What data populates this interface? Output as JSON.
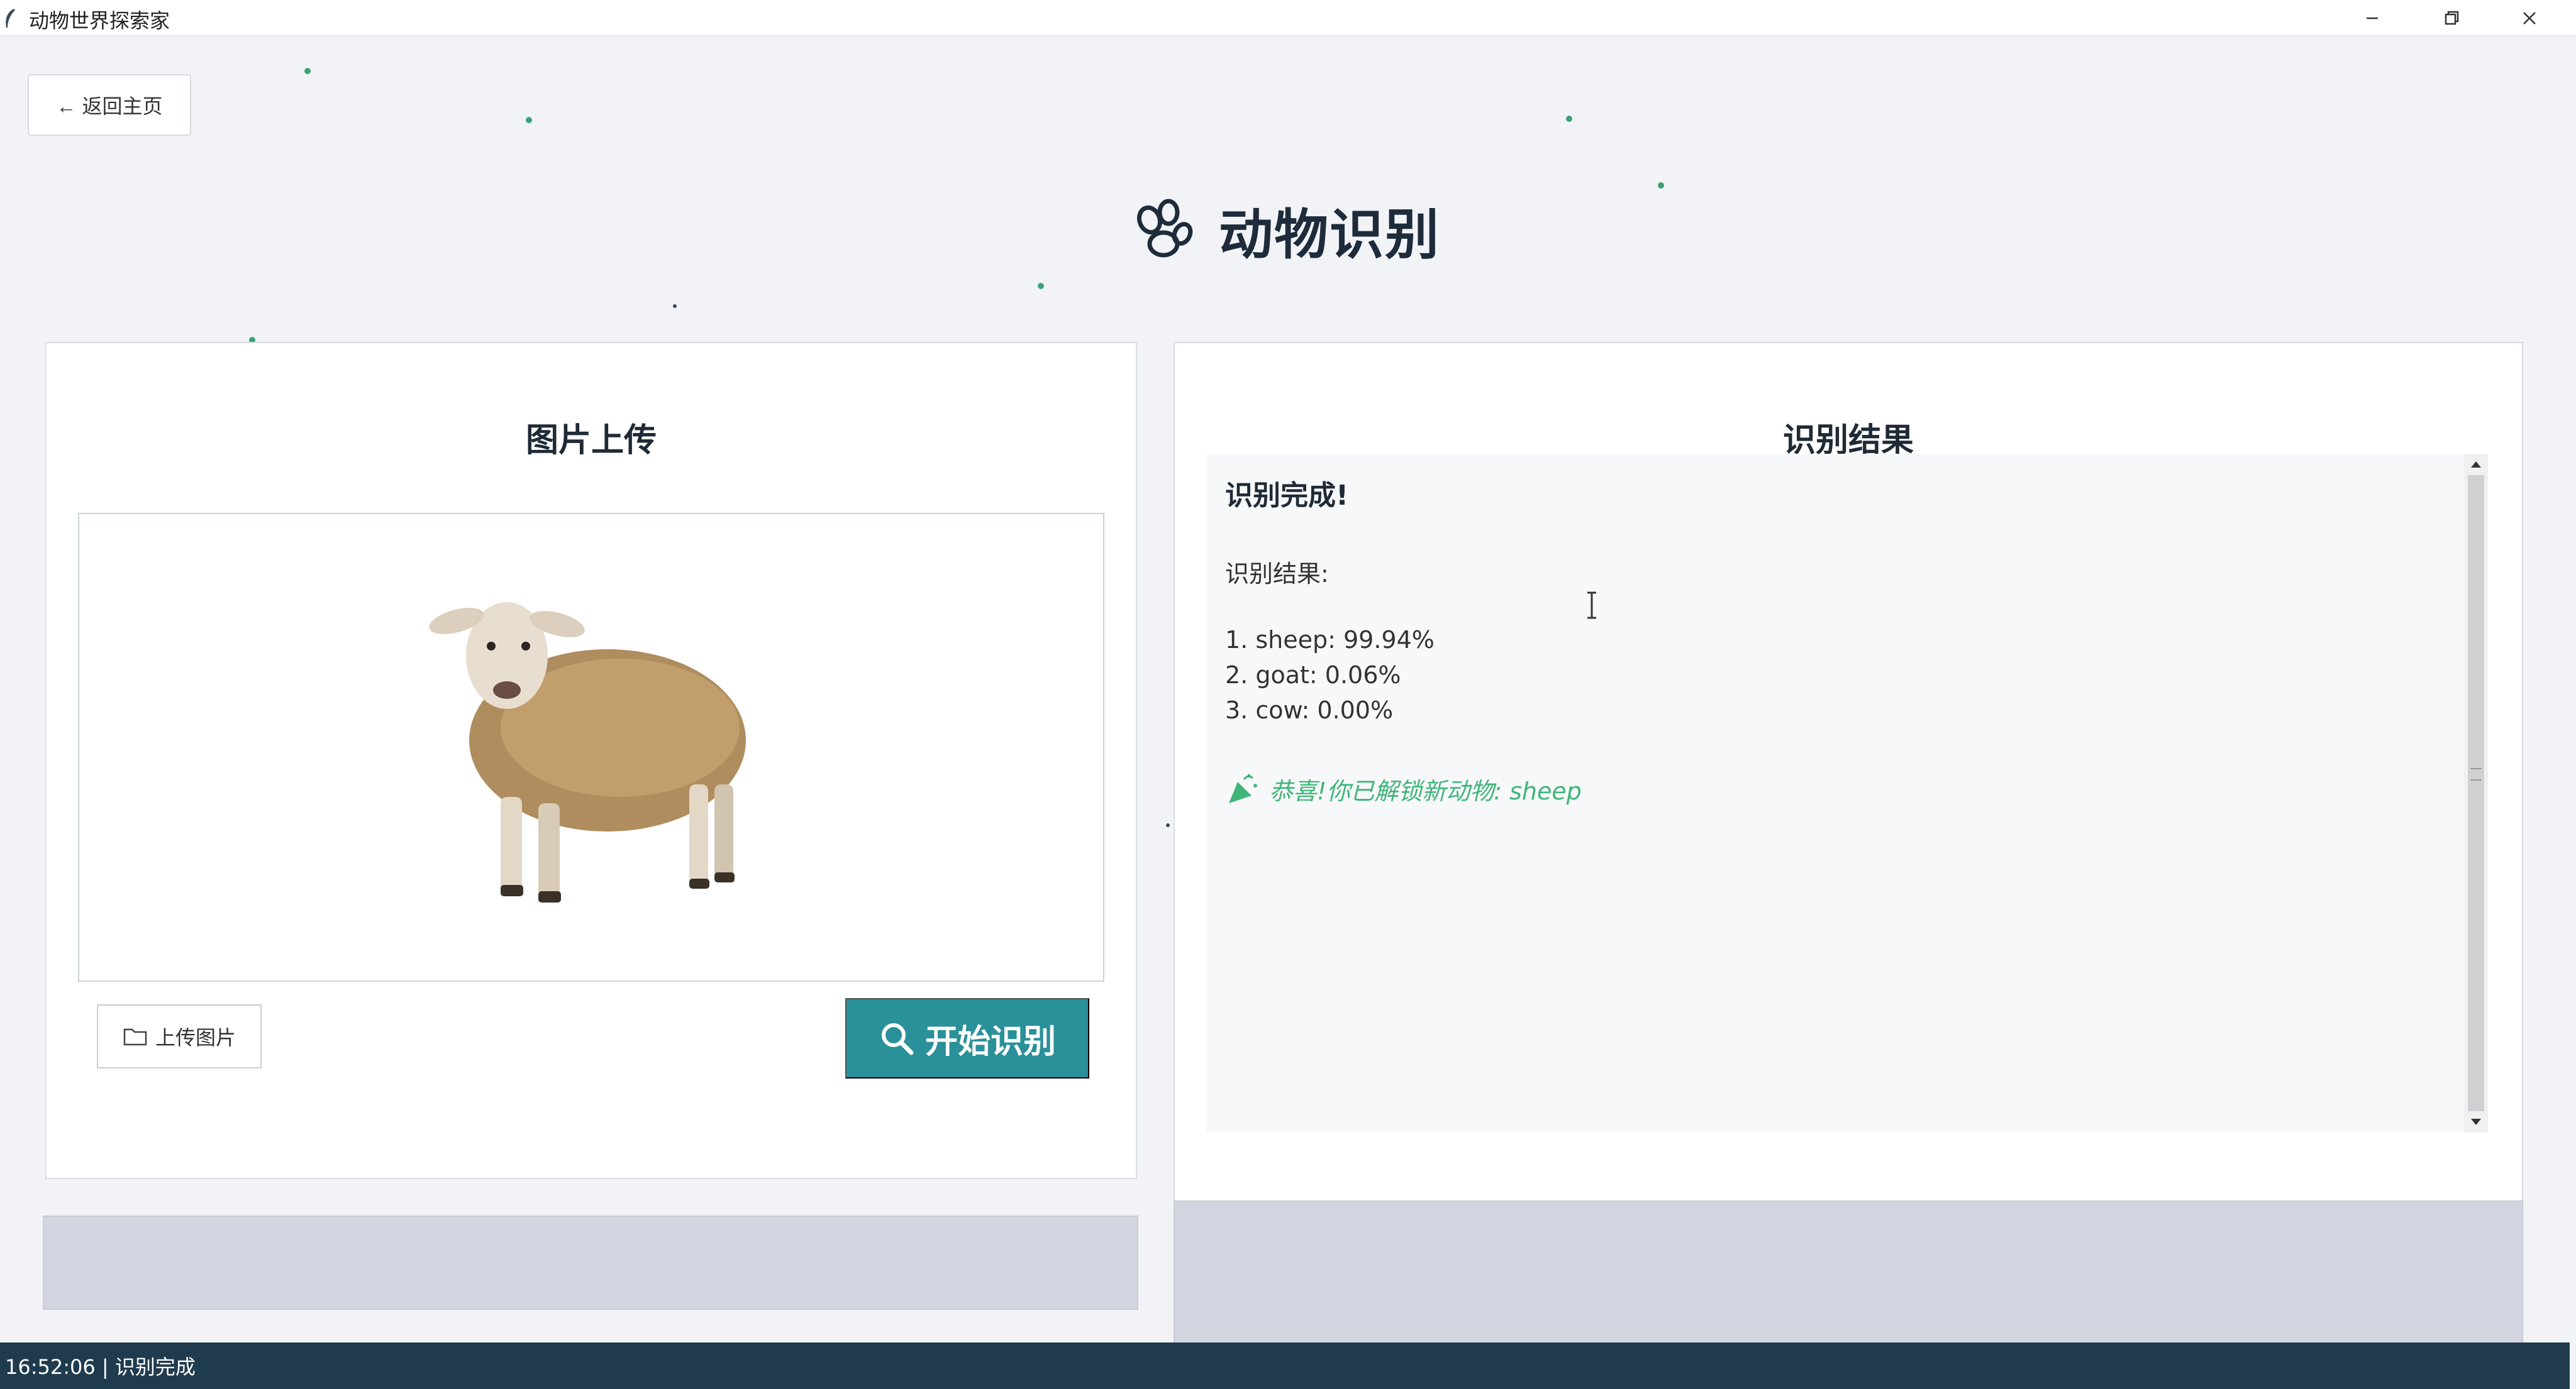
{
  "window": {
    "title": "动物世界探索家",
    "controls": [
      "minimize",
      "restore",
      "close"
    ]
  },
  "nav": {
    "back_label": "← 返回主页"
  },
  "page": {
    "title": "动物识别",
    "title_icon": "paw-icon"
  },
  "upload_panel": {
    "title": "图片上传",
    "image_alt": "sheep",
    "upload_button_label": "上传图片",
    "upload_button_icon": "folder-icon",
    "start_button_label": "开始识别",
    "start_button_icon": "search-icon"
  },
  "result_panel": {
    "title": "识别结果",
    "heading": "识别完成!",
    "label": "识别结果:",
    "results": [
      "1. sheep: 99.94%",
      "2. goat: 0.06%",
      "3. cow: 0.00%"
    ],
    "unlock_message": "恭喜!你已解锁新动物: sheep",
    "unlock_icon": "party-popper-icon"
  },
  "status": {
    "text": "16:52:06 | 识别完成"
  },
  "colors": {
    "accent": "#2a9099",
    "statusbar": "#1f3b4d",
    "success_text": "#3fb57a",
    "progress_bg": "#d3d6e0"
  }
}
